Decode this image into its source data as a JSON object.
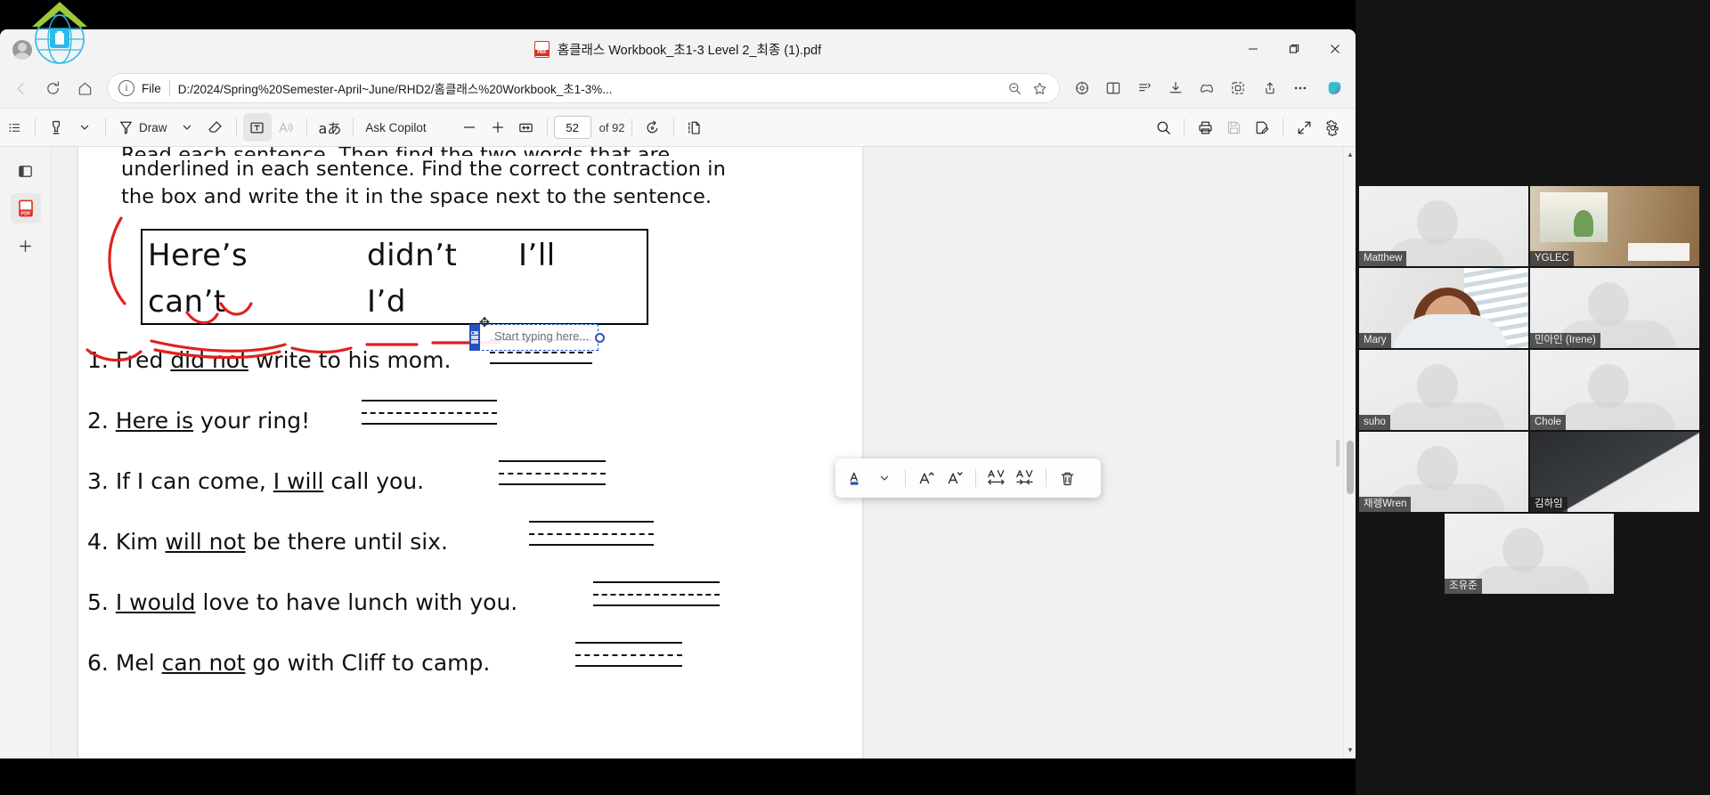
{
  "window": {
    "tab_title": "홈클래스 Workbook_초1-3 Level 2_최종 (1).pdf",
    "pdf_icon": "pdf-file-icon",
    "minimize": "–",
    "maximize": "❐",
    "close": "✕"
  },
  "addressbar": {
    "back_icon": "back-arrow-icon",
    "reload_icon": "reload-icon",
    "home_icon": "home-icon",
    "info_icon": "info-circle-icon",
    "scheme_label": "File",
    "url": "D:/2024/Spring%20Semester-April~June/RHD2/홈클래스%20Workbook_초1-3%...",
    "zoom_icon": "zoom-out-icon",
    "favorite_icon": "star-icon",
    "icons": [
      {
        "name": "browser-essentials-icon",
        "glyph": "essentials"
      },
      {
        "name": "split-screen-icon",
        "glyph": "split"
      },
      {
        "name": "collections-icon",
        "glyph": "collections"
      },
      {
        "name": "downloads-icon",
        "glyph": "download"
      },
      {
        "name": "games-icon",
        "glyph": "games"
      },
      {
        "name": "extensions-icon",
        "glyph": "extensions"
      },
      {
        "name": "share-icon",
        "glyph": "share"
      },
      {
        "name": "settings-more-icon",
        "glyph": "..."
      },
      {
        "name": "copilot-icon",
        "glyph": "copilot"
      }
    ]
  },
  "pdf_toolbar": {
    "left_items": [
      {
        "name": "table-of-contents-button",
        "label": "",
        "icon": "list-icon"
      },
      {
        "name": "highlight-button",
        "label": "",
        "icon": "highlighter-icon"
      },
      {
        "name": "highlight-dropdown",
        "label": "",
        "icon": "chevron-down-icon"
      },
      {
        "name": "draw-button",
        "label": "Draw",
        "icon": "pen-icon"
      },
      {
        "name": "draw-dropdown",
        "label": "",
        "icon": "chevron-down-icon"
      },
      {
        "name": "erase-button",
        "label": "",
        "icon": "eraser-icon"
      },
      {
        "name": "add-text-button",
        "label": "",
        "icon": "text-box-icon"
      },
      {
        "name": "read-aloud-button",
        "label": "",
        "icon": "read-aloud-icon"
      },
      {
        "name": "translate-button",
        "label": "",
        "icon": "translate-icon"
      },
      {
        "name": "ask-copilot-button",
        "label": "Ask Copilot",
        "icon": ""
      }
    ],
    "zoom_out": "–",
    "zoom_in": "+",
    "fit_page_icon": "fit-to-width-icon",
    "page_current": "52",
    "page_total": "of 92",
    "rotate_icon": "rotate-icon",
    "page_view_icon": "page-view-icon",
    "right_items": [
      {
        "name": "search-button",
        "icon": "search-icon"
      },
      {
        "name": "print-button",
        "icon": "printer-icon"
      },
      {
        "name": "save-button",
        "icon": "save-disk-icon"
      },
      {
        "name": "save-as-button",
        "icon": "save-as-icon"
      },
      {
        "name": "fullscreen-button",
        "icon": "expand-icon"
      },
      {
        "name": "settings-button",
        "icon": "gear-icon"
      }
    ]
  },
  "left_rail": [
    {
      "name": "sidebar-toggle-icon",
      "glyph": "panel"
    },
    {
      "name": "pdf-app-icon",
      "glyph": "pdf"
    },
    {
      "name": "add-tab-icon",
      "glyph": "+"
    }
  ],
  "worksheet": {
    "instruction_clipped": "Read each sentence. Then find the two words that are",
    "instruction_line2": "underlined in each sentence. Find the correct contraction in",
    "instruction_line3": "the box and write the it in the space next to the sentence.",
    "word_box": [
      [
        "Here’s",
        "didn’t",
        "I’ll"
      ],
      [
        "can’t",
        "I’d",
        ""
      ]
    ],
    "questions": [
      {
        "num": "1.",
        "pre": "Fred ",
        "underlined": "did not",
        "post": " write to his mom."
      },
      {
        "num": "2.",
        "pre": "",
        "underlined": "Here is",
        "post": " your ring!"
      },
      {
        "num": "3.",
        "pre": "If I can come, ",
        "underlined": "I will",
        "post": " call you."
      },
      {
        "num": "4.",
        "pre": "Kim ",
        "underlined": "will not",
        "post": " be there until six."
      },
      {
        "num": "5.",
        "pre": "",
        "underlined": "I would",
        "post": " love to have lunch with you."
      },
      {
        "num": "6.",
        "pre": "Mel ",
        "underlined": "can not",
        "post": " go with Cliff to camp."
      }
    ]
  },
  "text_annotation": {
    "placeholder": "Start typing here...",
    "move_handle_icon": "move-handle-icon",
    "resize_handle_icon": "resize-handle-icon"
  },
  "format_toolbar": {
    "items": [
      {
        "name": "font-color-button",
        "icon": "font-color-icon"
      },
      {
        "name": "font-color-dropdown",
        "icon": "chevron-down-icon"
      },
      {
        "name": "increase-font-size-button",
        "icon": "increase-font-size-icon"
      },
      {
        "name": "decrease-font-size-button",
        "icon": "decrease-font-size-icon"
      },
      {
        "name": "increase-letter-spacing-button",
        "icon": "increase-spacing-icon"
      },
      {
        "name": "decrease-letter-spacing-button",
        "icon": "decrease-spacing-icon"
      },
      {
        "name": "delete-annotation-button",
        "icon": "trash-icon"
      }
    ]
  },
  "video_panel": {
    "participants": [
      {
        "name": "Matthew",
        "feed": "blank",
        "active": false
      },
      {
        "name": "YGLEC",
        "feed": "room",
        "active": false
      },
      {
        "name": "Mary",
        "feed": "mary",
        "active": true
      },
      {
        "name": "민아인 (Irene)",
        "feed": "blank",
        "active": false
      },
      {
        "name": "suho",
        "feed": "blank",
        "active": false
      },
      {
        "name": "Chole",
        "feed": "blank",
        "active": false
      },
      {
        "name": "채렝Wren",
        "feed": "blank",
        "active": false
      },
      {
        "name": "김하임",
        "feed": "dark",
        "active": false
      },
      {
        "name": "조유준",
        "feed": "blank",
        "active": false
      }
    ]
  },
  "colors": {
    "accent_blue": "#2a52be",
    "active_speaker": "#c6f24a",
    "pdf_red": "#d93025",
    "ink_red": "#e02020"
  }
}
